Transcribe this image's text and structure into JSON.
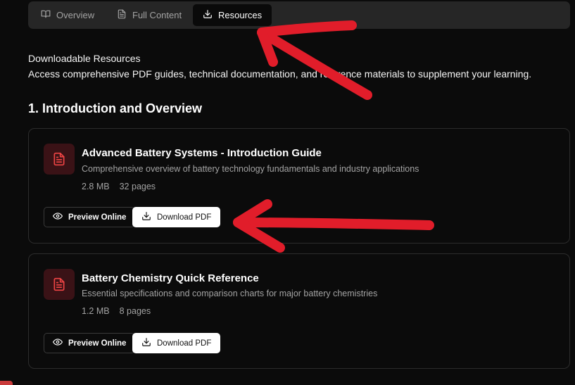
{
  "tabs": [
    {
      "label": "Overview",
      "icon": "book-open-icon",
      "active": false
    },
    {
      "label": "Full Content",
      "icon": "file-text-icon",
      "active": false
    },
    {
      "label": "Resources",
      "icon": "download-icon",
      "active": true
    }
  ],
  "section": {
    "title": "Downloadable Resources",
    "description": "Access comprehensive PDF guides, technical documentation, and reference materials to supplement your learning."
  },
  "group": {
    "title": "1. Introduction and Overview"
  },
  "resources": [
    {
      "title": "Advanced Battery Systems - Introduction Guide",
      "description": "Comprehensive overview of battery technology fundamentals and industry applications",
      "size": "2.8 MB",
      "pages": "32 pages",
      "preview_label": "Preview Online",
      "download_label": "Download PDF"
    },
    {
      "title": "Battery Chemistry Quick Reference",
      "description": "Essential specifications and comparison charts for major battery chemistries",
      "size": "1.2 MB",
      "pages": "8 pages",
      "preview_label": "Preview Online",
      "download_label": "Download PDF"
    }
  ],
  "colors": {
    "background": "#0b0b0b",
    "tabbar": "#262626",
    "icon_accent": "#ef4444",
    "icon_bg": "#3a1216",
    "annotation": "#e11d2a"
  }
}
